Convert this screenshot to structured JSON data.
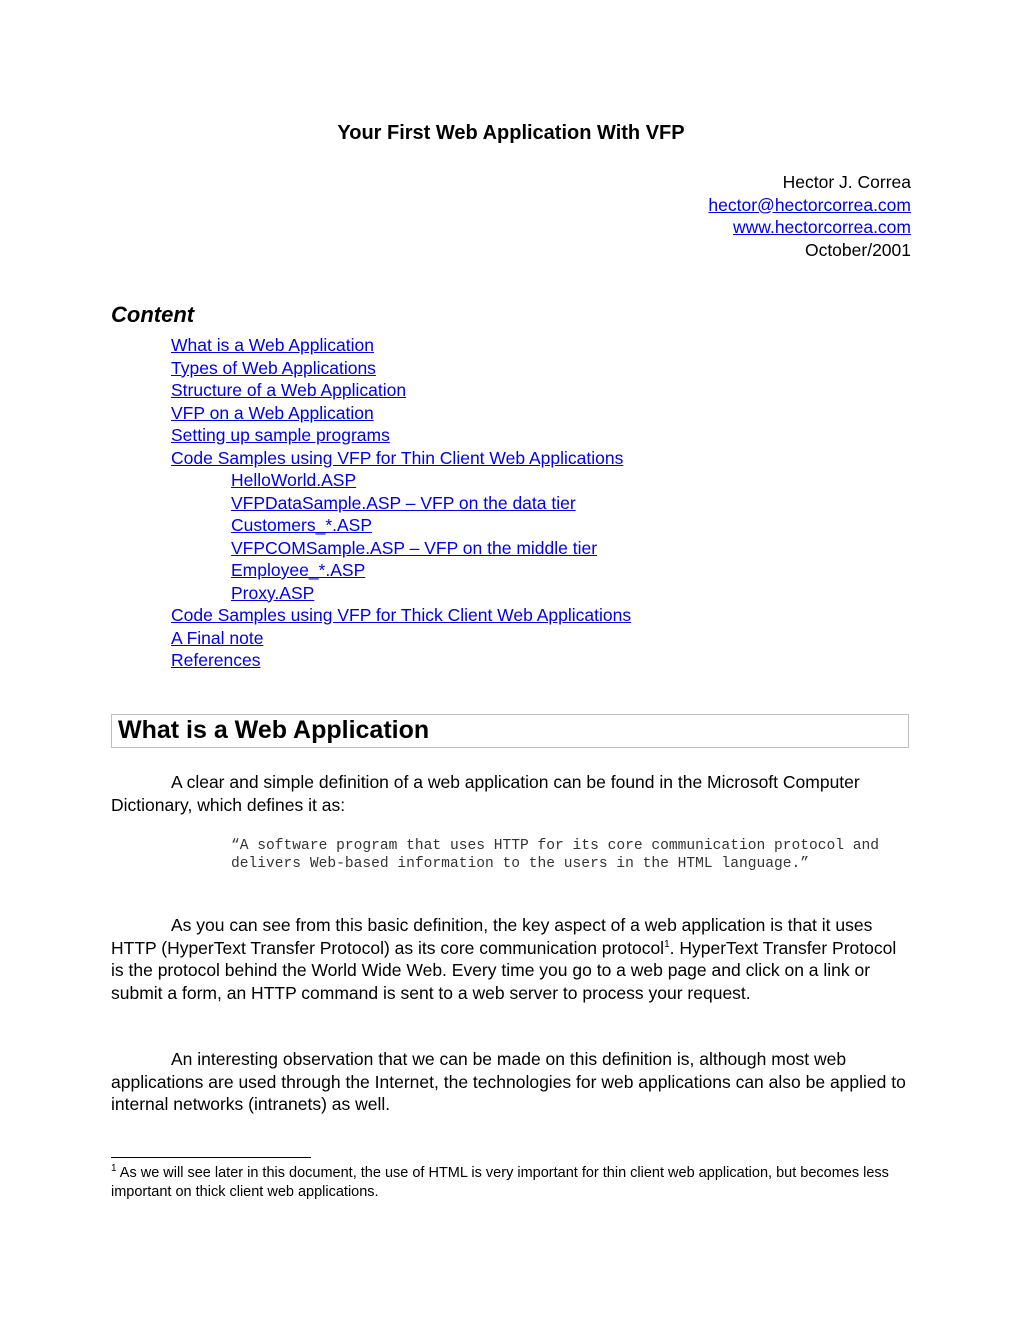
{
  "document": {
    "title": "Your First Web Application With VFP",
    "author": {
      "name": "Hector J. Correa",
      "email": "hector@hectorcorrea.com",
      "website": "www.hectorcorrea.com",
      "date": "October/2001"
    },
    "content_heading": "Content",
    "toc": [
      {
        "label": "What is a Web Application",
        "level": 1
      },
      {
        "label": "Types of Web Applications",
        "level": 1
      },
      {
        "label": "Structure of a Web Application",
        "level": 1
      },
      {
        "label": "VFP on a Web Application",
        "level": 1
      },
      {
        "label": "Setting up sample programs",
        "level": 1
      },
      {
        "label": "Code Samples using VFP for Thin Client Web Applications",
        "level": 1
      },
      {
        "label": "HelloWorld.ASP",
        "level": 2
      },
      {
        "label": "VFPDataSample.ASP – VFP on the data tier",
        "level": 2
      },
      {
        "label": "Customers_*.ASP",
        "level": 2
      },
      {
        "label": "VFPCOMSample.ASP – VFP on the middle tier",
        "level": 2
      },
      {
        "label": "Employee_*.ASP",
        "level": 2
      },
      {
        "label": "Proxy.ASP",
        "level": 2
      },
      {
        "label": "Code Samples using VFP for Thick Client Web Applications",
        "level": 1
      },
      {
        "label": "A Final note",
        "level": 1
      },
      {
        "label": "References",
        "level": 1
      }
    ],
    "section_heading": "What is a Web Application",
    "paragraphs": {
      "p1": "A clear and simple definition of a web application can be found in the Microsoft Computer Dictionary, which defines it as:",
      "quote": "“A software program that uses HTTP for its core communication protocol and delivers Web-based information to the users in the HTML language.”",
      "p2_before": "As you can see from this basic definition, the key aspect of a web application is that it uses HTTP (HyperText Transfer Protocol) as its core communication protocol",
      "p2_sup": "1",
      "p2_after": ". HyperText Transfer Protocol is the protocol behind the World Wide Web. Every time you go to a web page and click on a link or submit a form, an HTTP command is sent to a web server to process your request.",
      "p3": "An interesting observation that we can be made on this definition is, although most web applications are used through the Internet, the technologies for web applications can also be applied to internal networks (intranets) as well."
    },
    "footnote": {
      "number": "1",
      "text": " As we will see later in this document, the use of HTML is very important for thin client web application, but becomes less important on thick client web applications."
    }
  }
}
